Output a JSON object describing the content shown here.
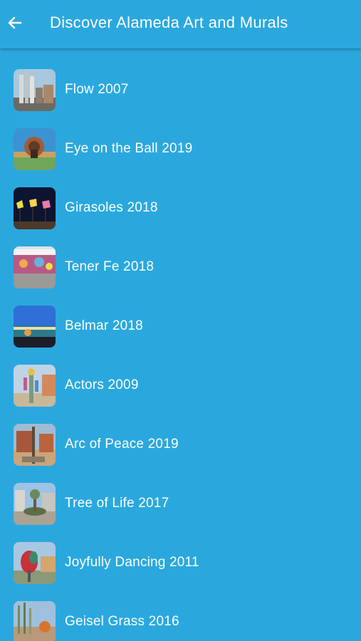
{
  "header": {
    "title": "Discover Alameda Art and Murals",
    "back_icon": "arrow-left-icon"
  },
  "colors": {
    "background": "#2aa8de",
    "text": "#ffffff"
  },
  "items": [
    {
      "label": "Flow 2007"
    },
    {
      "label": "Eye on the Ball 2019"
    },
    {
      "label": "Girasoles 2018"
    },
    {
      "label": "Tener Fe 2018"
    },
    {
      "label": "Belmar 2018"
    },
    {
      "label": "Actors 2009"
    },
    {
      "label": "Arc of Peace 2019"
    },
    {
      "label": "Tree of Life 2017"
    },
    {
      "label": "Joyfully Dancing 2011"
    },
    {
      "label": "Geisel Grass 2016"
    }
  ]
}
